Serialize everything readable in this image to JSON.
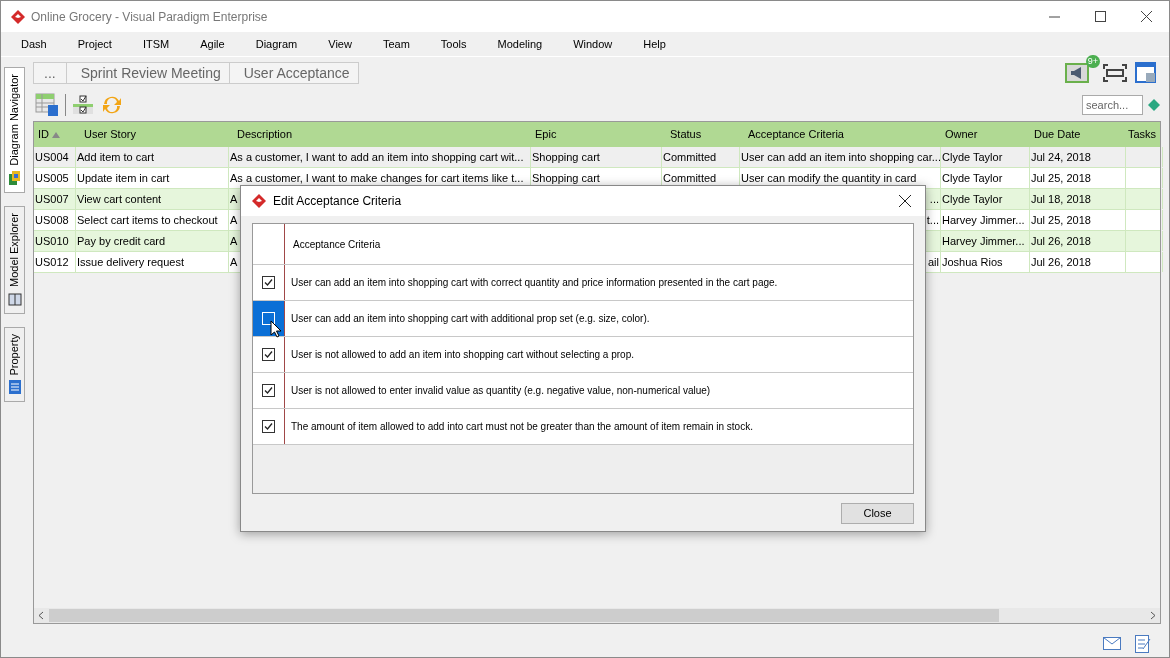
{
  "window": {
    "title": "Online Grocery - Visual Paradigm Enterprise"
  },
  "menu": [
    "Dash",
    "Project",
    "ITSM",
    "Agile",
    "Diagram",
    "View",
    "Team",
    "Tools",
    "Modeling",
    "Window",
    "Help"
  ],
  "breadcrumb": [
    "...",
    "Sprint Review Meeting",
    "User Acceptance"
  ],
  "notification_badge": "9+",
  "search": {
    "placeholder": "search..."
  },
  "side_tabs": [
    {
      "label": "Diagram Navigator",
      "selected": true
    },
    {
      "label": "Model Explorer",
      "selected": false
    },
    {
      "label": "Property",
      "selected": false
    }
  ],
  "table": {
    "columns": [
      {
        "label": "ID",
        "sorted": true
      },
      {
        "label": "User Story",
        "sorted": false
      },
      {
        "label": "Description",
        "sorted": false
      },
      {
        "label": "Epic",
        "sorted": false
      },
      {
        "label": "Status",
        "sorted": false
      },
      {
        "label": "Acceptance Criteria",
        "sorted": false
      },
      {
        "label": "Owner",
        "sorted": false
      },
      {
        "label": "Due Date",
        "sorted": false
      },
      {
        "label": "Tasks",
        "sorted": false
      }
    ],
    "rows": [
      {
        "selected": true,
        "cells": [
          "US004",
          "Add item to cart",
          "As a customer, I want to add an item into shopping cart wit...",
          "Shopping cart",
          "Committed",
          "User can add an item into shopping car...",
          "Clyde Taylor",
          "Jul 24, 2018",
          ""
        ]
      },
      {
        "selected": false,
        "cells": [
          "US005",
          "Update item in cart",
          "As a customer, I want to make changes for cart items like t...",
          "Shopping cart",
          "Committed",
          "User can modify the quantity in card",
          "Clyde Taylor",
          "Jul 25, 2018",
          ""
        ]
      },
      {
        "selected": false,
        "cells": [
          "US007",
          "View cart content",
          "A",
          "",
          "",
          "...",
          "Clyde Taylor",
          "Jul 18, 2018",
          ""
        ]
      },
      {
        "selected": false,
        "cells": [
          "US008",
          "Select cart items to checkout",
          "A",
          "",
          "",
          "t...",
          "Harvey Jimmer...",
          "Jul 25, 2018",
          ""
        ]
      },
      {
        "selected": false,
        "cells": [
          "US010",
          "Pay by credit card",
          "A",
          "",
          "",
          "",
          "Harvey Jimmer...",
          "Jul 26, 2018",
          ""
        ]
      },
      {
        "selected": false,
        "cells": [
          "US012",
          "Issue delivery request",
          "A",
          "",
          "",
          "ail",
          "Joshua Rios",
          "Jul 26, 2018",
          ""
        ]
      }
    ]
  },
  "dialog": {
    "title": "Edit Acceptance Criteria",
    "header": "Acceptance Criteria",
    "items": [
      {
        "text": "User can add an item into shopping cart with correct quantity and price information presented in the cart page.",
        "checked": true,
        "selected": false
      },
      {
        "text": "User can add an item into shopping cart with additional prop set (e.g. size, color).",
        "checked": false,
        "selected": true
      },
      {
        "text": "User is not allowed to add an item into shopping cart without selecting a prop.",
        "checked": true,
        "selected": false
      },
      {
        "text": "User is not allowed to enter invalid value as quantity (e.g. negative value, non-numerical value)",
        "checked": true,
        "selected": false
      },
      {
        "text": "The amount of item allowed to add into cart must not be greater than the amount of item remain in stock.",
        "checked": true,
        "selected": false
      }
    ],
    "close_button": "Close"
  }
}
